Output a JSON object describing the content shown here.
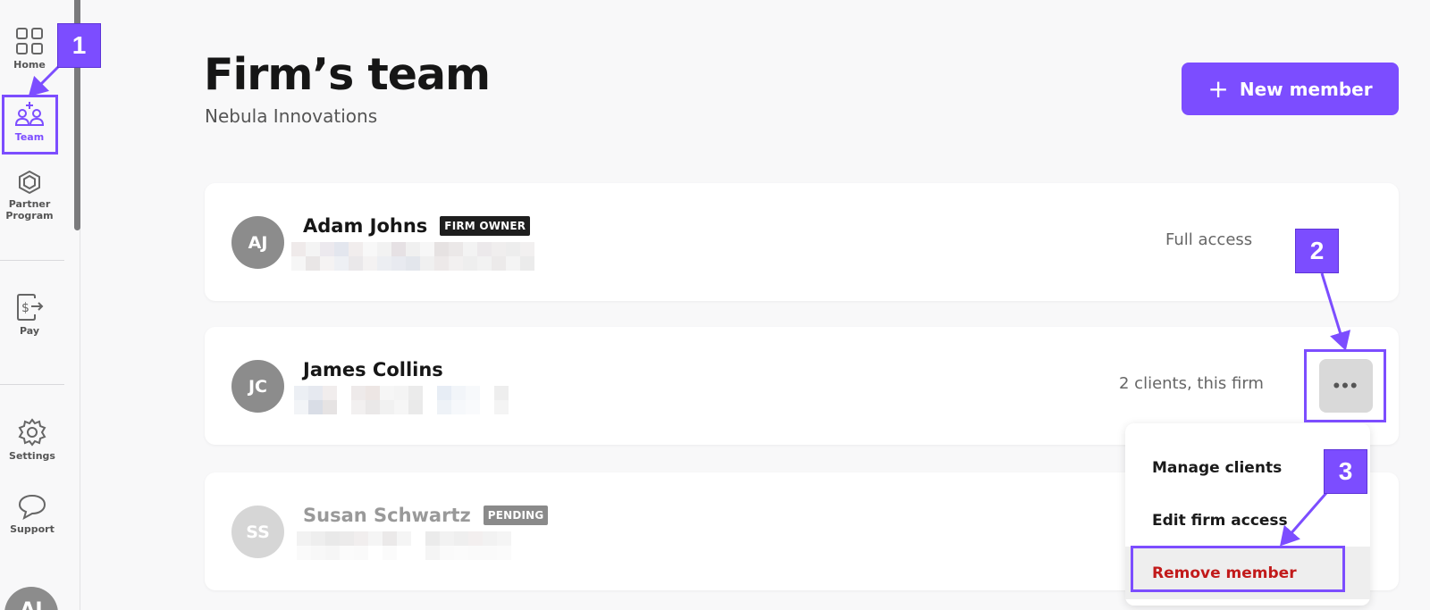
{
  "sidebar": {
    "items": [
      {
        "label": "Home",
        "icon": "grid-icon"
      },
      {
        "label": "Team",
        "icon": "team-icon"
      },
      {
        "label": "Partner Program",
        "icon": "gem-icon"
      },
      {
        "label": "Pay",
        "icon": "pay-icon"
      },
      {
        "label": "Settings",
        "icon": "gear-icon"
      },
      {
        "label": "Support",
        "icon": "chat-bubble-icon"
      }
    ],
    "user_initials": "AJ",
    "active": "Team",
    "accent": "#7c4dff"
  },
  "header": {
    "title": "Firm’s team",
    "subtitle": "Nebula Innovations",
    "new_member_label": "New member"
  },
  "members": [
    {
      "initials": "AJ",
      "name": "Adam Johns",
      "badge": "FIRM OWNER",
      "access": "Full access",
      "status": "active"
    },
    {
      "initials": "JC",
      "name": "James Collins",
      "badge": "",
      "access": "2 clients, this firm",
      "status": "active"
    },
    {
      "initials": "SS",
      "name": "Susan Schwartz",
      "badge": "PENDING",
      "access": "",
      "status": "pending"
    }
  ],
  "more_menu": {
    "items": [
      "Manage clients",
      "Edit firm access",
      "Remove member"
    ]
  },
  "annotations": [
    "1",
    "2",
    "3"
  ]
}
